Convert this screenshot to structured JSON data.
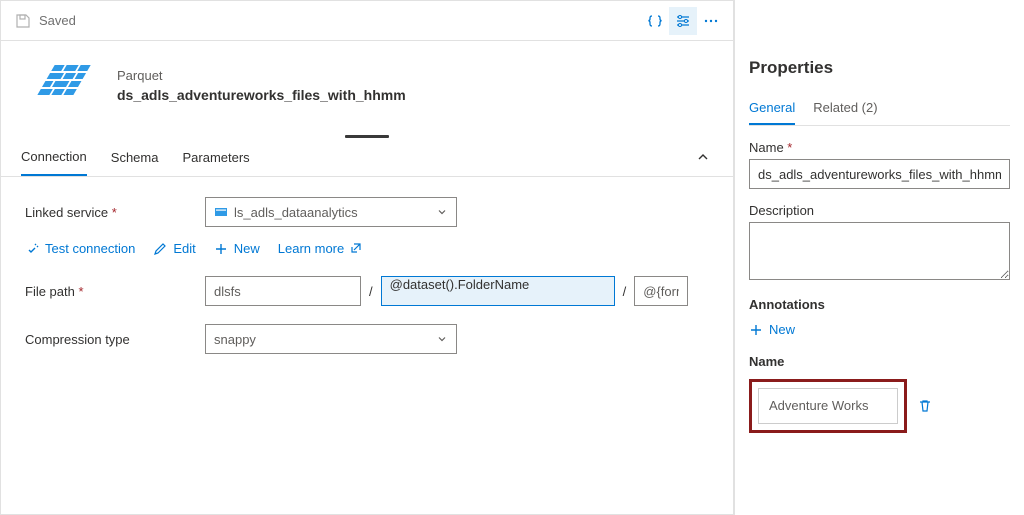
{
  "toolbar": {
    "saved_label": "Saved"
  },
  "header": {
    "subtitle": "Parquet",
    "title": "ds_adls_adventureworks_files_with_hhmm"
  },
  "tabs": {
    "connection": "Connection",
    "schema": "Schema",
    "parameters": "Parameters"
  },
  "connection": {
    "linked_service_label": "Linked service *",
    "linked_service_value": "ls_adls_dataanalytics",
    "test_connection": "Test connection",
    "edit": "Edit",
    "new": "New",
    "learn_more": "Learn more",
    "file_path_label": "File path *",
    "fp_container": "dlsfs",
    "fp_folder": "@dataset().FolderName",
    "fp_file": "@{forma",
    "compression_label": "Compression type",
    "compression_value": "snappy"
  },
  "properties": {
    "panel_title": "Properties",
    "tab_general": "General",
    "tab_related": "Related (2)",
    "name_label": "Name *",
    "name_value": "ds_adls_adventureworks_files_with_hhmm",
    "description_label": "Description",
    "annotations_label": "Annotations",
    "new_label": "New",
    "anno_name_label": "Name",
    "anno_name_value": "Adventure Works"
  }
}
